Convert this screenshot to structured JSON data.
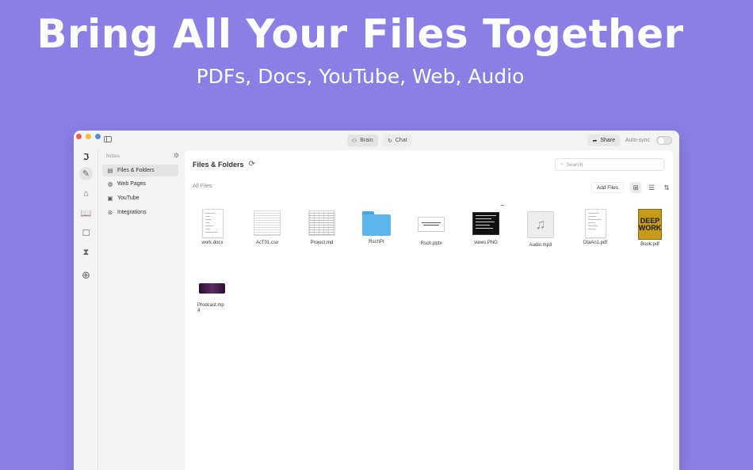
{
  "hero": {
    "title": "Bring All Your Files Together",
    "subtitle": "PDFs, Docs, YouTube, Web, Audio"
  },
  "titlebar": {
    "brain_label": "Brain",
    "chat_label": "Chat",
    "share_label": "Share",
    "autosync_label": "Auto-sync",
    "autosync_on": false
  },
  "notes": {
    "header": "Notes",
    "items": [
      {
        "label": "Files & Folders",
        "icon": "file-icon",
        "active": true
      },
      {
        "label": "Web Pages",
        "icon": "globe-icon",
        "active": false
      },
      {
        "label": "YouTube",
        "icon": "video-icon",
        "active": false
      },
      {
        "label": "Integrations",
        "icon": "plug-icon",
        "active": false
      }
    ]
  },
  "main": {
    "title": "Files & Folders",
    "search_placeholder": "Search",
    "section_label": "All Files",
    "add_files_label": "Add Files",
    "more_label": "...",
    "files": [
      {
        "name": "work.docx",
        "kind": "doc"
      },
      {
        "name": "AcT01.csv",
        "kind": "sheet"
      },
      {
        "name": "Project.md",
        "kind": "sheet"
      },
      {
        "name": "RschPr",
        "kind": "folder"
      },
      {
        "name": "Rsch.pptx",
        "kind": "slide"
      },
      {
        "name": "views.PNG",
        "kind": "image"
      },
      {
        "name": "Audio.mp3",
        "kind": "audio"
      },
      {
        "name": "DtaAn1.pdf",
        "kind": "doc"
      },
      {
        "name": "Book.pdf",
        "kind": "book"
      },
      {
        "name": "Prodcast.mp4",
        "kind": "video"
      }
    ],
    "book_cover_text": [
      "DEEP",
      "WORK"
    ]
  },
  "colors": {
    "background": "#8b7fe6",
    "window": "#f3f3f3",
    "folder": "#5cb5ee",
    "book": "#c79a1a"
  }
}
